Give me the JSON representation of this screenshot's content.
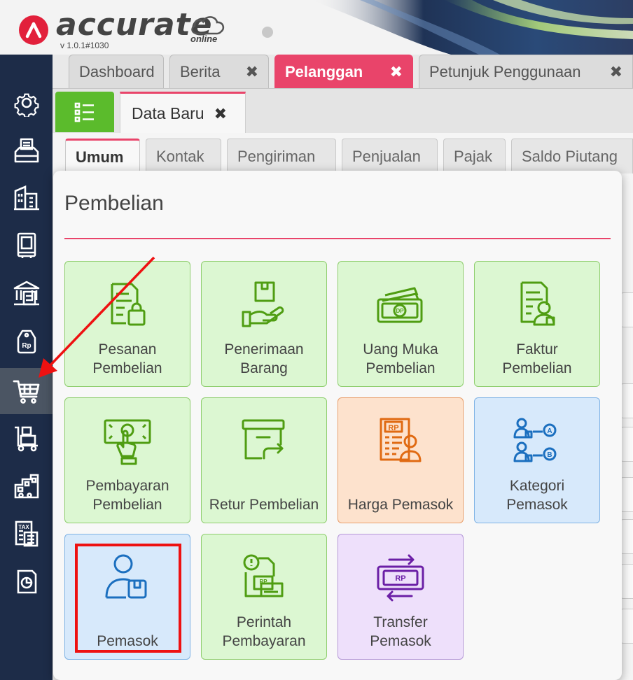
{
  "header": {
    "brand": "accurate",
    "brand_sub": "online",
    "version": "v 1.0.1#1030",
    "colors": {
      "brand_red": "#e2203b",
      "sidebar": "#1d2c48",
      "accent_pink": "#e9446a"
    }
  },
  "sidebar": {
    "items": [
      {
        "icon": "gear-icon"
      },
      {
        "icon": "fax-machine-icon"
      },
      {
        "icon": "building-icon"
      },
      {
        "icon": "ledger-book-icon"
      },
      {
        "icon": "bank-icon"
      },
      {
        "icon": "price-tag-rp-icon"
      },
      {
        "icon": "shopping-cart-icon",
        "active": true
      },
      {
        "icon": "warehouse-cart-icon"
      },
      {
        "icon": "factory-icon"
      },
      {
        "icon": "tax-document-icon"
      },
      {
        "icon": "report-chart-icon"
      }
    ]
  },
  "tabs": [
    {
      "label": "Dashboard",
      "closable": false
    },
    {
      "label": "Berita",
      "closable": true
    },
    {
      "label": "Pelanggan",
      "closable": true,
      "active": true
    },
    {
      "label": "Petunjuk Penggunaan",
      "closable": true
    }
  ],
  "close_symbol": "✖",
  "subbar": {
    "form_tab_label": "Data Baru"
  },
  "form_tabs": [
    "Umum",
    "Kontak",
    "Pengiriman",
    "Penjualan",
    "Pajak",
    "Saldo Piutang"
  ],
  "popup": {
    "title": "Pembelian",
    "tiles": [
      {
        "label1": "Pesanan",
        "label2": "Pembelian",
        "color": "green",
        "icon": "purchase-order-icon"
      },
      {
        "label1": "Penerimaan",
        "label2": "Barang",
        "color": "green",
        "icon": "goods-receipt-icon"
      },
      {
        "label1": "Uang Muka",
        "label2": "Pembelian",
        "color": "green",
        "icon": "down-payment-icon"
      },
      {
        "label1": "Faktur",
        "label2": "Pembelian",
        "color": "green",
        "icon": "purchase-invoice-icon"
      },
      {
        "label1": "Pembayaran",
        "label2": "Pembelian",
        "color": "green",
        "icon": "purchase-payment-icon"
      },
      {
        "label1": "",
        "label2": "Retur Pembelian",
        "color": "green",
        "icon": "purchase-return-icon"
      },
      {
        "label1": "",
        "label2": "Harga Pemasok",
        "color": "orange",
        "icon": "supplier-price-icon"
      },
      {
        "label1": "Kategori",
        "label2": "Pemasok",
        "color": "blue",
        "icon": "supplier-category-icon"
      },
      {
        "label1": "",
        "label2": "Pemasok",
        "color": "blue",
        "icon": "supplier-icon"
      },
      {
        "label1": "Perintah",
        "label2": "Pembayaran",
        "color": "green",
        "icon": "payment-order-icon"
      },
      {
        "label1": "Transfer",
        "label2": "Pemasok",
        "color": "purple",
        "icon": "supplier-transfer-icon"
      }
    ]
  },
  "icon_text": {
    "dp": "DP",
    "rp": "RP",
    "rp_lower": "Rp",
    "tax": "TAX",
    "cat_a": "A",
    "cat_b": "B"
  }
}
